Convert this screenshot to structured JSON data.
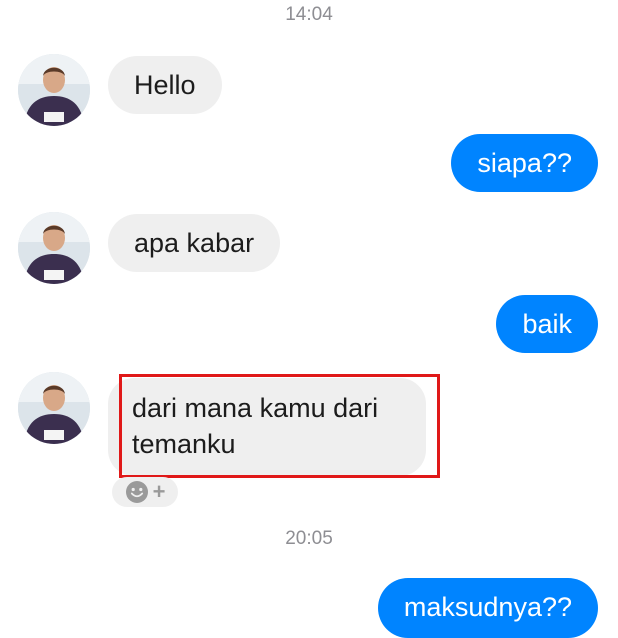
{
  "messages": {
    "time_1": "14:04",
    "m1": "Hello",
    "m2": "siapa??",
    "m3": "apa kabar",
    "m4": "baik",
    "m5_line1": "dari mana kamu dari",
    "m5_line2": "temanku",
    "time_2": "20:05",
    "m6": "maksudnya??"
  },
  "reaction": {
    "icon": "smiley-icon",
    "plus": "+"
  },
  "colors": {
    "outgoing_bubble": "#0084ff",
    "incoming_bubble": "#efefef",
    "highlight_box": "#e01818",
    "timestamp_text": "#8e8e93"
  }
}
